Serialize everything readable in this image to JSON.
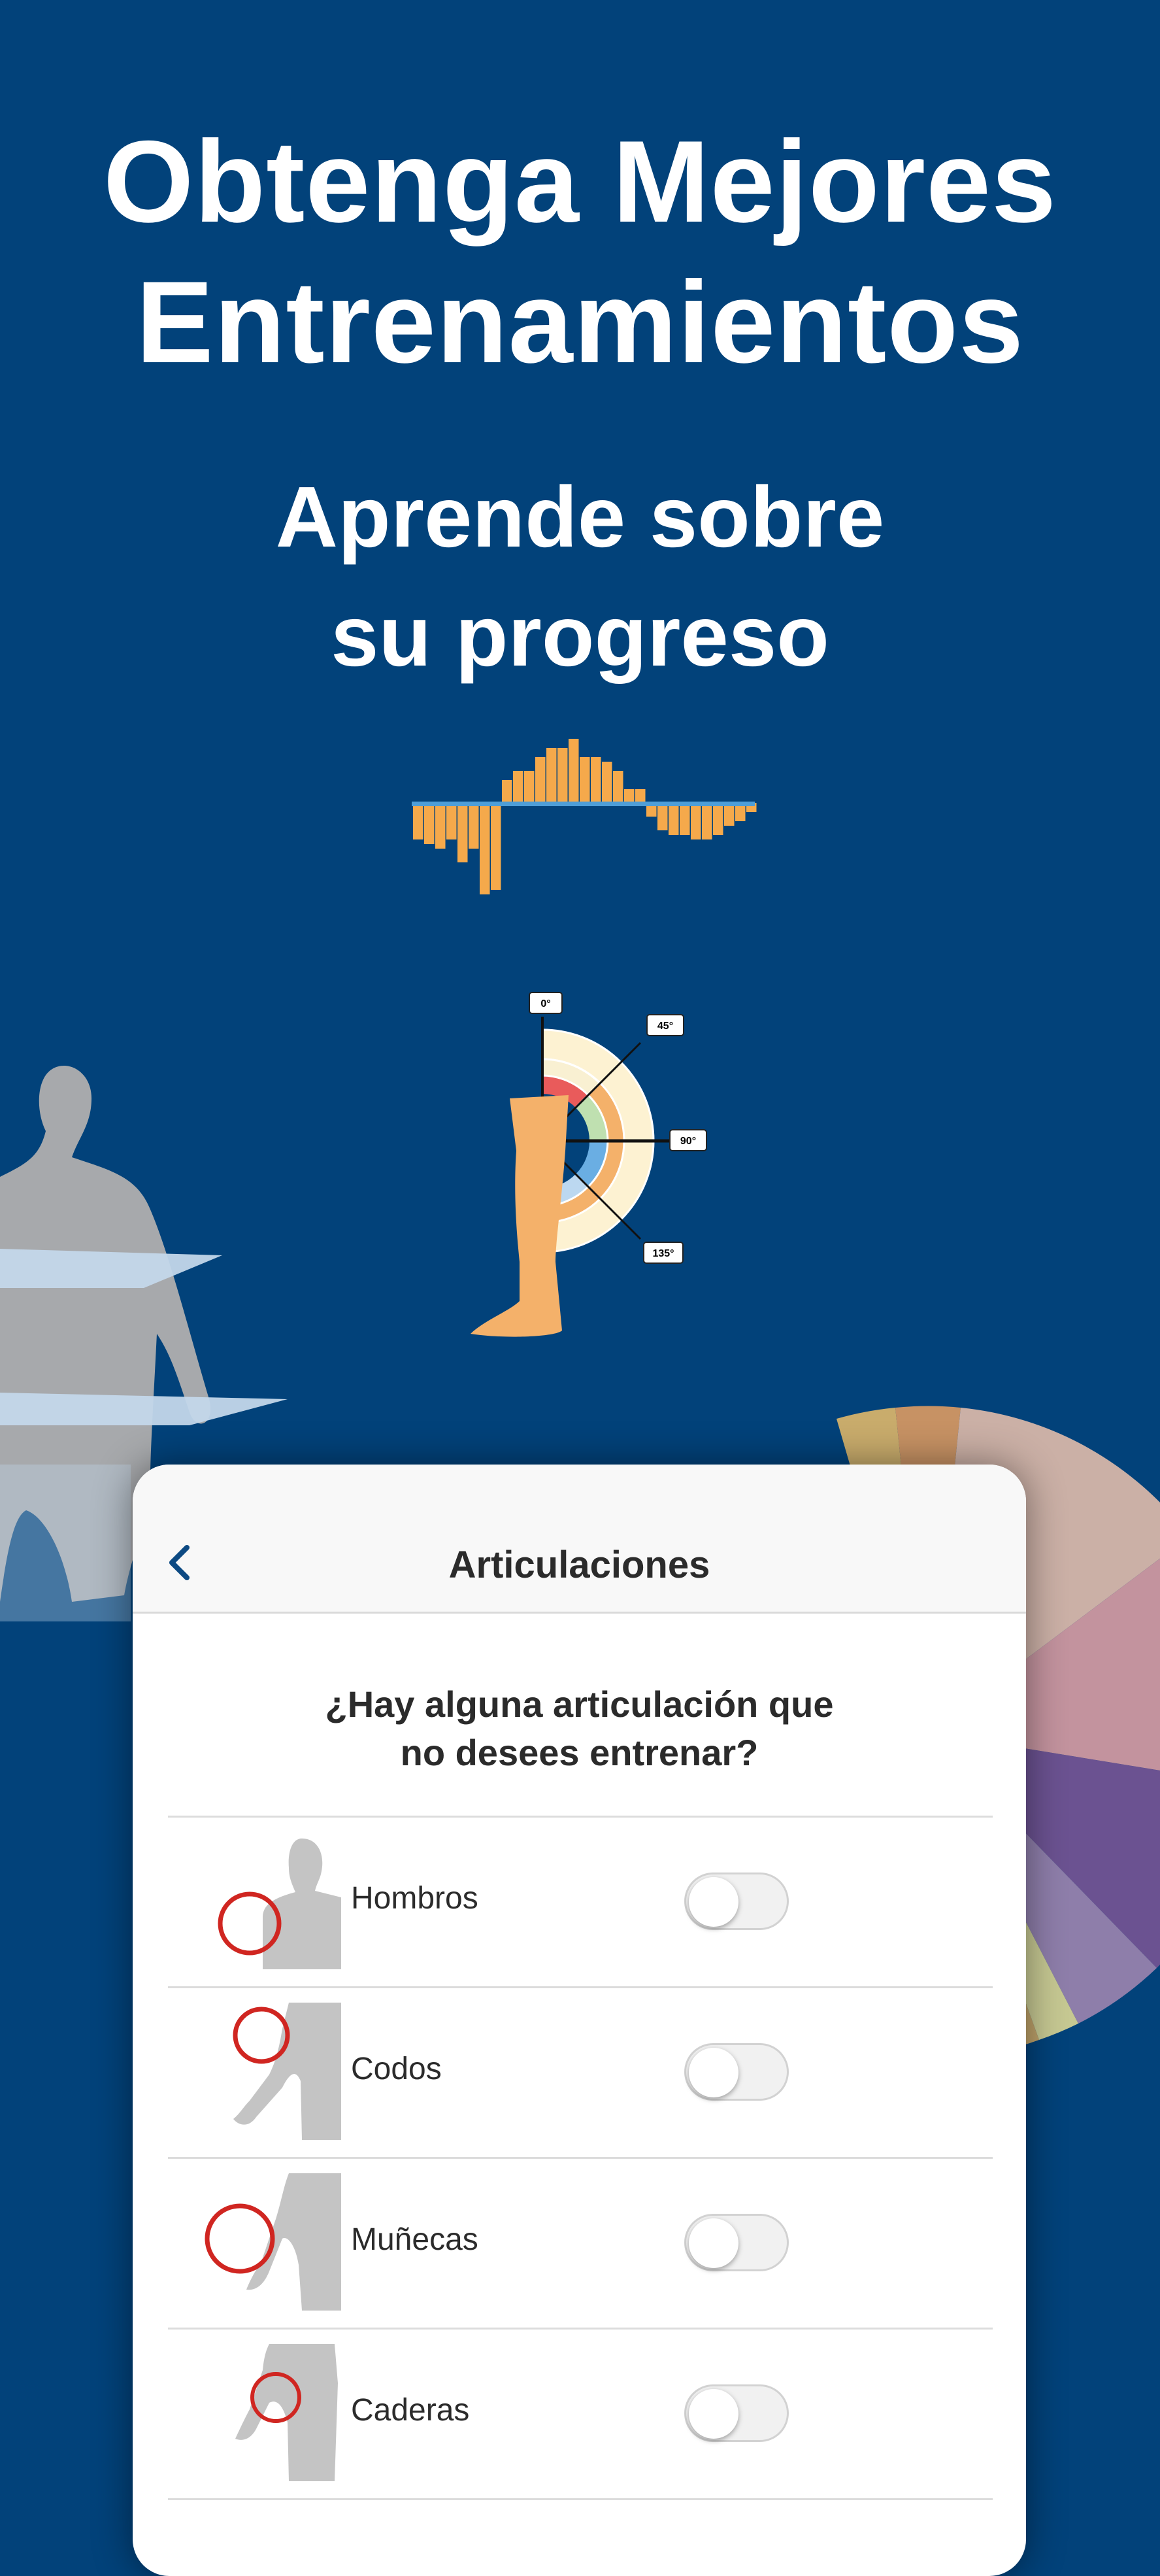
{
  "headline": {
    "line1": "Obtenga Mejores",
    "line2": "Entrenamientos",
    "sub1": "Aprende sobre",
    "sub2": "su progreso"
  },
  "bar_graphic": {
    "values": [
      -8,
      -9,
      -10,
      -8,
      -13,
      -10,
      -20,
      -19,
      5,
      7,
      7,
      10,
      12,
      12,
      14,
      10,
      10,
      9,
      7,
      3,
      3,
      -3,
      -6,
      -7,
      -7,
      -8,
      -8,
      -7,
      -5,
      -4,
      -2
    ],
    "colors": {
      "bar": "#f5a94b",
      "axis": "#4e9ed8"
    }
  },
  "joint_chart": {
    "angle_labels": [
      "0°",
      "45°",
      "90°",
      "135°"
    ]
  },
  "card": {
    "title": "Articulaciones",
    "question_line1": "¿Hay alguna articulación que",
    "question_line2": "no desees entrenar?",
    "items": [
      {
        "label": "Hombros",
        "on": false
      },
      {
        "label": "Codos",
        "on": false
      },
      {
        "label": "Muñecas",
        "on": false
      },
      {
        "label": "Caderas",
        "on": false
      }
    ]
  },
  "colors": {
    "background": "#02427a",
    "text": "#ffffff",
    "accent_back": "#0d4a83",
    "highlight_circle": "#d02621",
    "silhouette": "#c4c4c4"
  }
}
